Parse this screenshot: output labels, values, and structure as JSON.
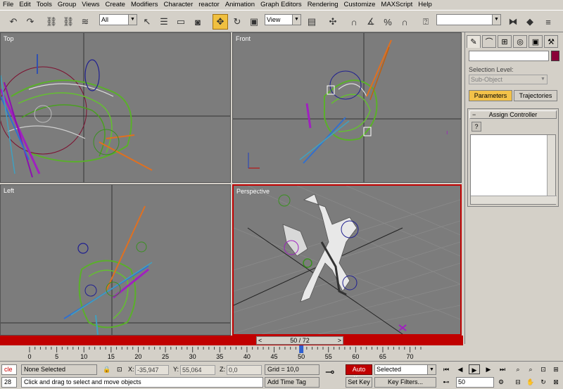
{
  "menu": [
    "File",
    "Edit",
    "Tools",
    "Group",
    "Views",
    "Create",
    "Modifiers",
    "Character",
    "reactor",
    "Animation",
    "Graph Editors",
    "Rendering",
    "Customize",
    "MAXScript",
    "Help"
  ],
  "toolbar": {
    "selection_filter": "All",
    "reference_coord": "View",
    "named_selection": ""
  },
  "viewports": {
    "top": "Top",
    "front": "Front",
    "left": "Left",
    "perspective": "Perspective"
  },
  "command_panel": {
    "selection_level_label": "Selection Level:",
    "sub_object": "Sub-Object",
    "parameters_tab": "Parameters",
    "trajectories_tab": "Trajectories",
    "rollout_title": "Assign Controller",
    "rollout_toggle": "−",
    "help_button": "?",
    "color_swatch": "#8a0038"
  },
  "time_slider": {
    "label": "50 / 72",
    "current": 50,
    "total": 72,
    "prev_arrow": "<",
    "next_arrow": ">"
  },
  "track_ticks": [
    "0",
    "5",
    "10",
    "15",
    "20",
    "25",
    "30",
    "35",
    "40",
    "45",
    "50",
    "55",
    "60",
    "65",
    "70"
  ],
  "status": {
    "script_listener": "cle",
    "line_number": "28",
    "selection": "None Selected",
    "prompt": "Click and drag to select and move objects",
    "x_label": "X:",
    "x_value": "-35,947",
    "y_label": "Y:",
    "y_value": "55,064",
    "z_label": "Z:",
    "z_value": "0,0",
    "grid": "Grid = 10,0",
    "add_time_tag": "Add Time Tag",
    "auto_key": "Auto Key",
    "set_key": "Set Key",
    "key_mode": "Selected",
    "key_filters": "Key Filters...",
    "frame": "50"
  }
}
